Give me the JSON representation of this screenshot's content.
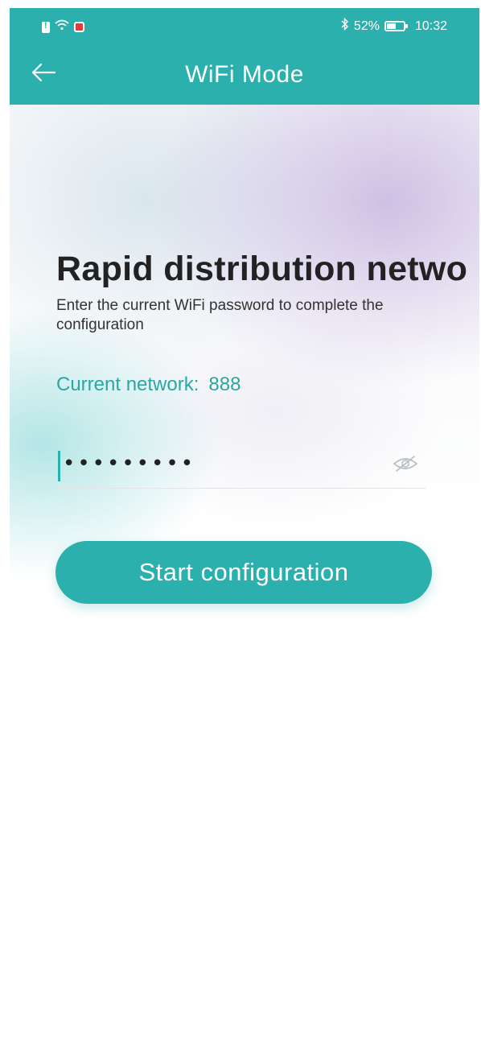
{
  "status_bar": {
    "battery_percent": "52%",
    "time": "10:32",
    "icons": [
      "sim-alert-icon",
      "wifi-icon",
      "notification-icon",
      "bluetooth-icon",
      "battery-icon"
    ]
  },
  "header": {
    "title": "WiFi Mode",
    "back_icon": "back-arrow-icon"
  },
  "main": {
    "heading": "Rapid distribution netwo",
    "description": "Enter the current WiFi password to complete the configuration",
    "network_label": "Current network:",
    "network_value": "888",
    "password_value": "•••••••••",
    "visibility_icon": "eye-slash-icon",
    "start_button_label": "Start configuration"
  },
  "colors": {
    "accent": "#2bb0ad",
    "accent_text": "#2aa7a4",
    "heading_text": "#222222"
  }
}
